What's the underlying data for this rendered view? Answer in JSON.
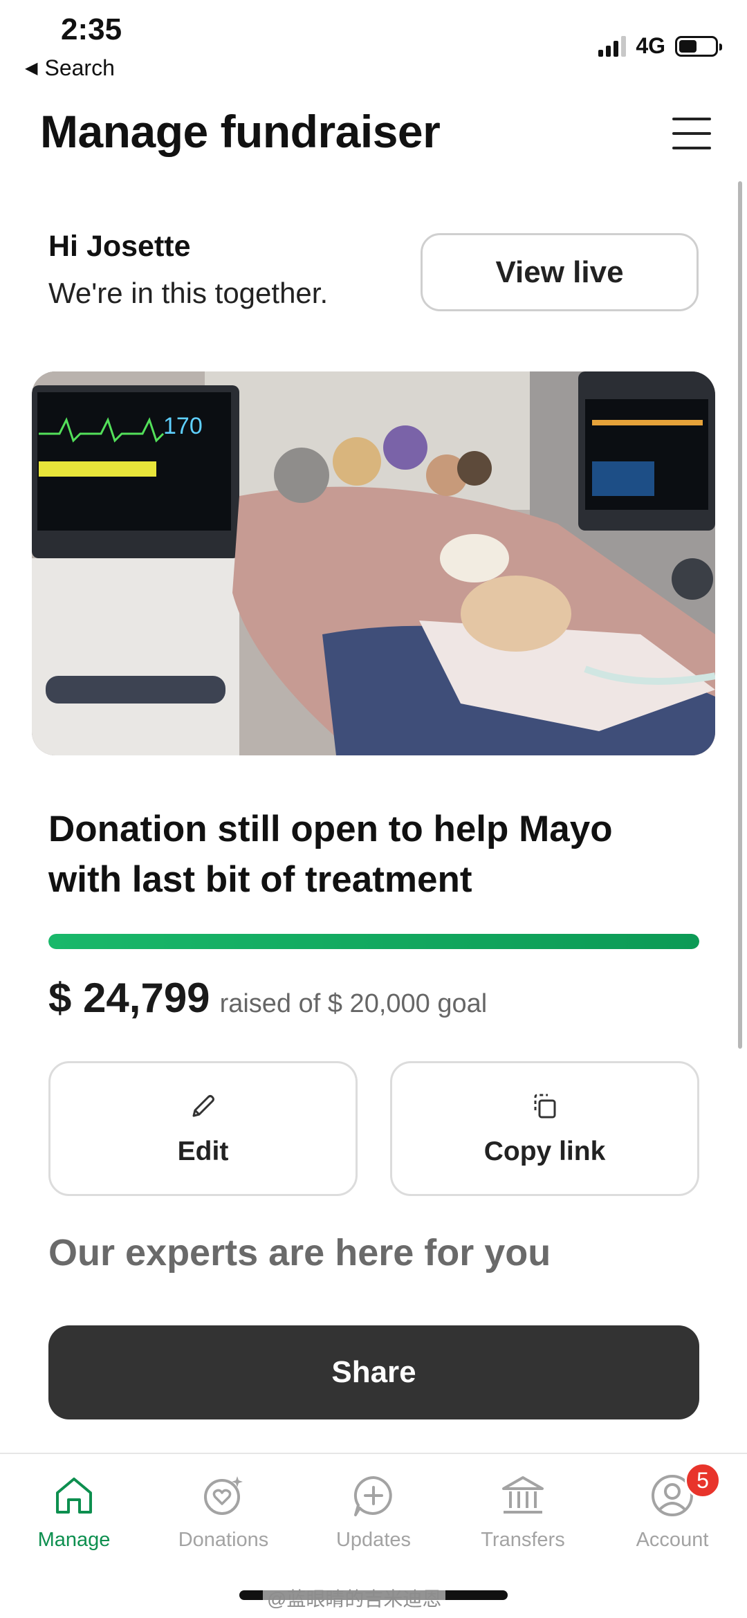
{
  "status_bar": {
    "time": "2:35",
    "back_label": "Search",
    "back_icon": "triangle-left-icon",
    "network": "4G",
    "battery_level": 0.5
  },
  "header": {
    "title": "Manage fundraiser",
    "menu_icon": "hamburger-icon"
  },
  "greeting": {
    "name": "Hi Josette",
    "message": "We're in this together.",
    "view_live_label": "View live"
  },
  "campaign": {
    "title": "Donation still open to help Mayo with last bit of treatment",
    "progress_fraction": 1.0,
    "raised": "$ 24,799",
    "goal_text": "raised of $ 20,000 goal",
    "image_monitor_value": "170"
  },
  "actions": {
    "edit_label": "Edit",
    "edit_icon": "pencil-icon",
    "copy_label": "Copy link",
    "copy_icon": "copy-icon"
  },
  "experts": {
    "heading": "Our experts are here for you"
  },
  "share": {
    "label": "Share"
  },
  "tabbar": {
    "items": [
      {
        "label": "Manage",
        "icon": "home-icon",
        "active": true
      },
      {
        "label": "Donations",
        "icon": "heart-sparkle-icon",
        "active": false
      },
      {
        "label": "Updates",
        "icon": "plus-bubble-icon",
        "active": false
      },
      {
        "label": "Transfers",
        "icon": "bank-icon",
        "active": false
      },
      {
        "label": "Account",
        "icon": "user-icon",
        "active": false,
        "badge": "5"
      }
    ]
  },
  "watermark": "@蓝眼睛的吉米迪恩",
  "colors": {
    "accent_green": "#0d8f4f",
    "progress_green": "#19b86a",
    "share_button": "#333333",
    "badge_red": "#e8342b",
    "inactive_gray": "#a3a3a3"
  }
}
